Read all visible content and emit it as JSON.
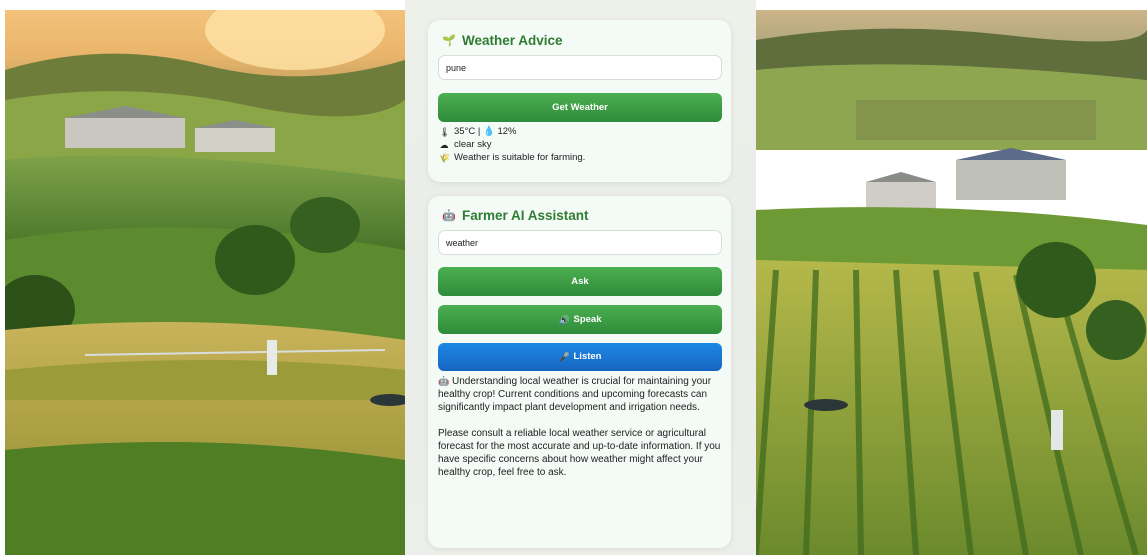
{
  "weather_card": {
    "title": "Weather Advice",
    "title_icon": "seedling-icon",
    "city_input": {
      "value": "pune",
      "placeholder": ""
    },
    "get_weather_label": "Get Weather",
    "temp_line": "35°C | 💧 12%",
    "sky_line": "clear sky",
    "advice_line": "Weather is suitable for farming."
  },
  "assistant_card": {
    "title": "Farmer AI Assistant",
    "title_icon": "robot-icon",
    "query_input": {
      "value": "weather",
      "placeholder": ""
    },
    "ask_label": "Ask",
    "speak_label": "Speak",
    "listen_label": "Listen",
    "answer_p1": "Understanding local weather is crucial for maintaining your healthy crop! Current conditions and upcoming forecasts can significantly impact plant development and irrigation needs.",
    "answer_p2": "Please consult a reliable local weather service or agricultural forecast for the most accurate and up-to-date information. If you have specific concerns about how weather might affect your healthy crop, feel free to ask."
  },
  "colors": {
    "accent_green": "#2e7d32",
    "button_green": "#43a047",
    "button_blue": "#1976d2"
  }
}
